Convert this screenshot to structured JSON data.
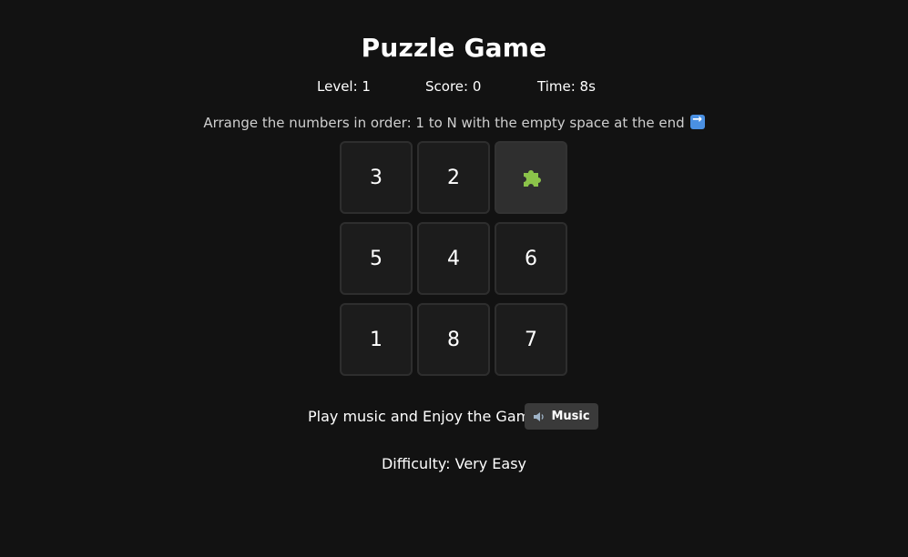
{
  "game": {
    "title": "Puzzle Game",
    "stats": {
      "level": "Level: 1",
      "score": "Score: 0",
      "time": "Time: 8s"
    },
    "instructions": "Arrange the numbers in order: 1 to N with the empty space at the end",
    "board": {
      "rows": 3,
      "cols": 3,
      "tiles": [
        "3",
        "2",
        "",
        "5",
        "4",
        "6",
        "1",
        "8",
        "7"
      ],
      "empty_icon": "puzzle-piece-icon"
    },
    "music": {
      "prompt": "Play music and Enjoy the Game",
      "button_label": "Music",
      "button_icon": "speaker-icon"
    },
    "difficulty": "Difficulty: Very Easy"
  },
  "colors": {
    "background": "#121212",
    "tile": "#1c1c1c",
    "empty_tile": "#2f2f2f",
    "button": "#3a3a3a",
    "puzzle_icon": "#8bc34a",
    "arrow_icon": "#4a90e2"
  }
}
